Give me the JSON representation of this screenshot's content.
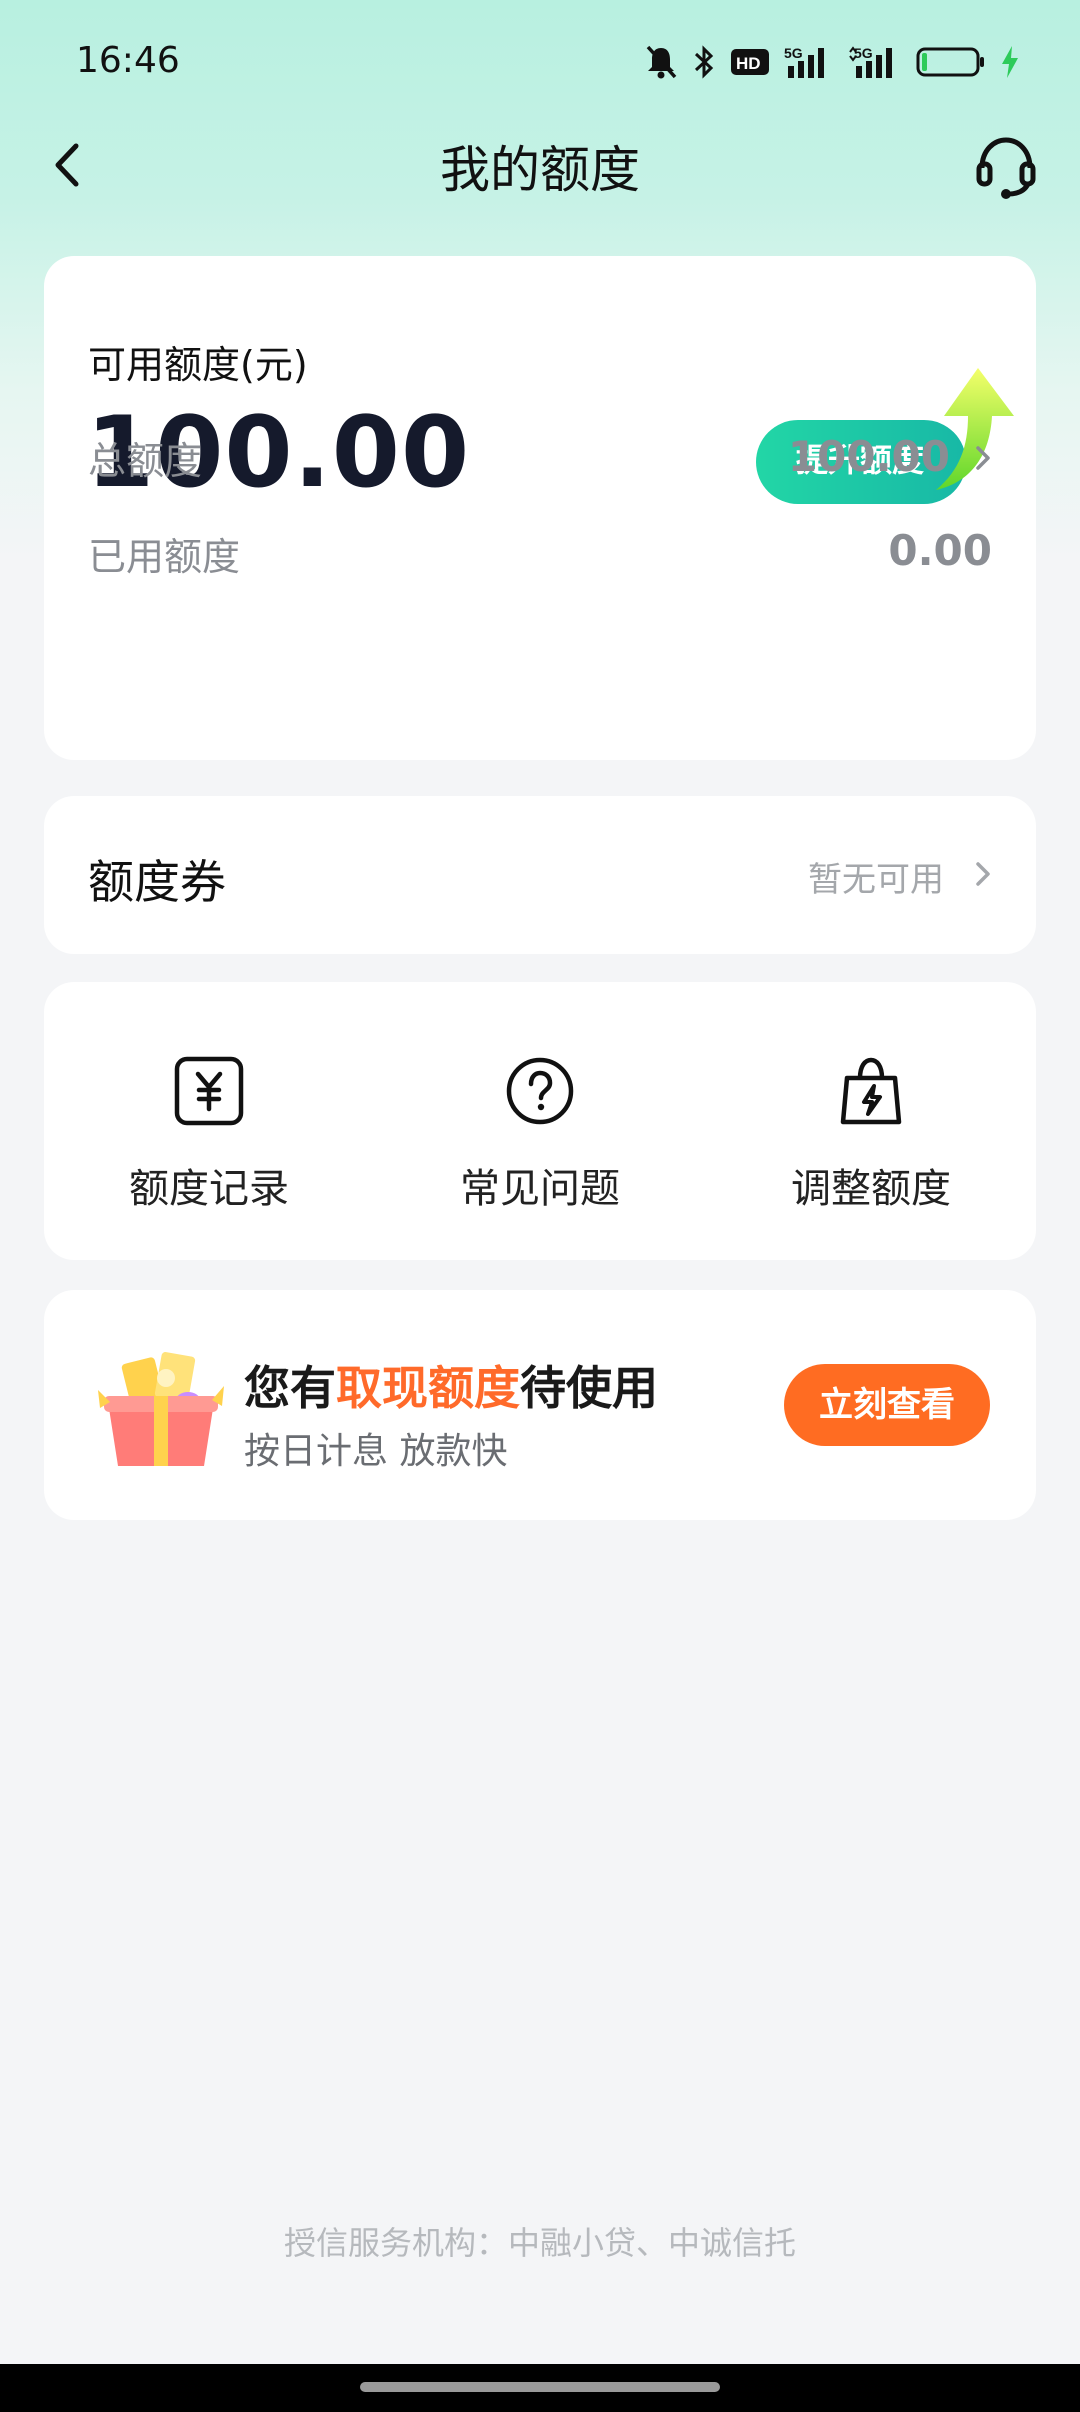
{
  "status_bar": {
    "time": "16:46"
  },
  "header": {
    "title": "我的额度"
  },
  "quota": {
    "available_label": "可用额度(元)",
    "available_amount": "100.00",
    "raise_button": "提升额度",
    "total_label": "总额度",
    "total_value": "100.00",
    "used_label": "已用额度",
    "used_value": "0.00"
  },
  "coupon": {
    "title": "额度券",
    "status": "暂无可用"
  },
  "shortcuts": [
    {
      "label": "额度记录",
      "icon": "yuan-icon"
    },
    {
      "label": "常见问题",
      "icon": "question-icon"
    },
    {
      "label": "调整额度",
      "icon": "bag-lightning-icon"
    }
  ],
  "promo": {
    "title_prefix": "您有",
    "title_highlight": "取现额度",
    "title_suffix": "待使用",
    "subtitle": "按日计息 放款快",
    "button": "立刻查看"
  },
  "footer": {
    "note": "授信服务机构：中融小贷、中诚信托"
  },
  "colors": {
    "accent_green": "#22d6a6",
    "orange": "#ff6c22",
    "header_gradient": "#b8f0e0"
  }
}
